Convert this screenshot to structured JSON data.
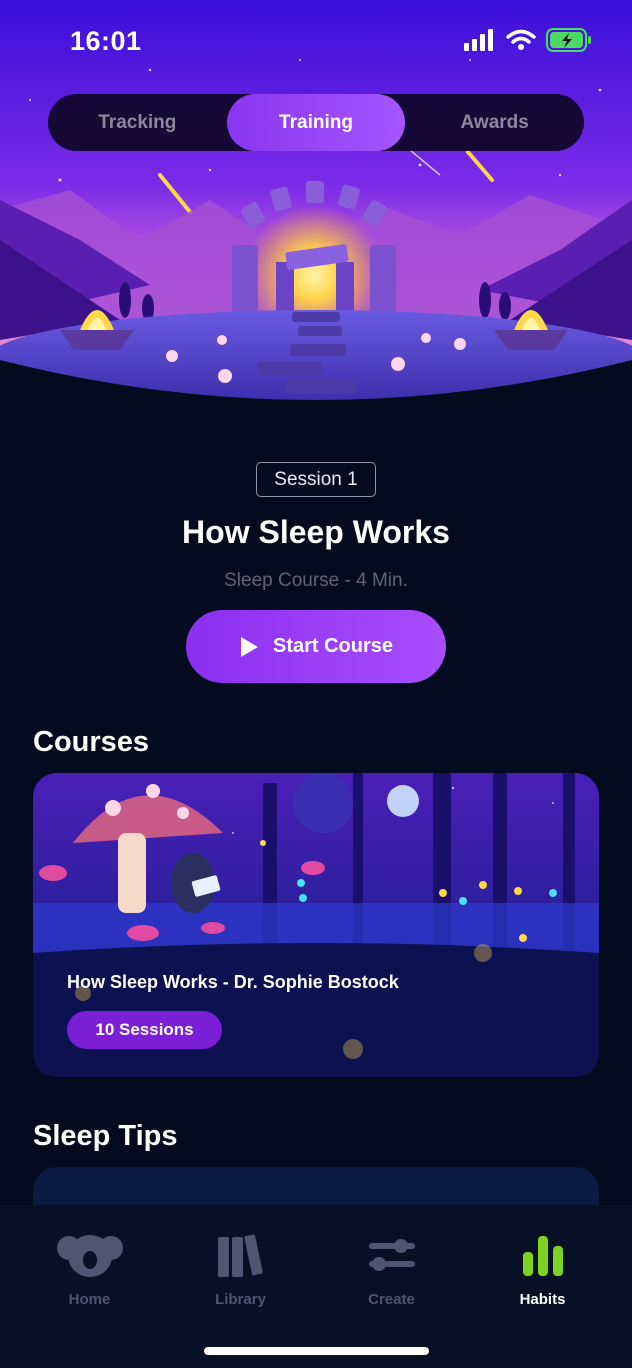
{
  "status_bar": {
    "time": "16:01",
    "battery_color": "#4cd964"
  },
  "segment": {
    "items": [
      {
        "label": "Tracking",
        "active": false
      },
      {
        "label": "Training",
        "active": true
      },
      {
        "label": "Awards",
        "active": false
      }
    ]
  },
  "session": {
    "badge": "Session 1",
    "title": "How Sleep Works",
    "subtitle": "Sleep Course - 4 Min.",
    "start_label": "Start Course"
  },
  "courses": {
    "heading": "Courses",
    "card": {
      "title": "How Sleep Works - Dr. Sophie Bostock",
      "sessions_label": "10 Sessions"
    }
  },
  "tips": {
    "heading": "Sleep Tips"
  },
  "tab_bar": {
    "items": [
      {
        "label": "Home",
        "icon": "koala-icon",
        "active": false
      },
      {
        "label": "Library",
        "icon": "books-icon",
        "active": false
      },
      {
        "label": "Create",
        "icon": "sliders-icon",
        "active": false
      },
      {
        "label": "Habits",
        "icon": "bar-chart-icon",
        "active": true
      }
    ],
    "active_color": "#7ed321"
  },
  "colors": {
    "accent": "#9b3ff8",
    "background": "#050b1f"
  }
}
